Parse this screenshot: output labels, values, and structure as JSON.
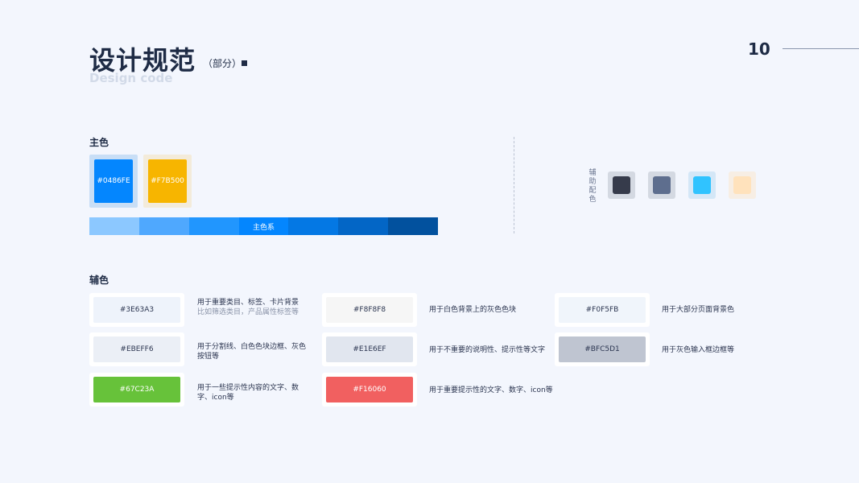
{
  "header": {
    "title": "设计规范",
    "title_sub": "（部分）",
    "subtitle": "Design code",
    "page_number": "10"
  },
  "primary": {
    "label": "主色",
    "swatches": [
      {
        "hex": "#0486FE",
        "color": "#0486FE",
        "frame": "#C8DEF6"
      },
      {
        "hex": "#F7B500",
        "color": "#F7B500",
        "frame": "#F3EBDA"
      }
    ],
    "scale": {
      "label": "主色系",
      "colors": [
        "#8CC8FF",
        "#4FA8FE",
        "#2196FE",
        "#0486FE",
        "#0478E4",
        "#0366C6",
        "#02519E"
      ]
    }
  },
  "aux_mini": {
    "label": "辅助配色",
    "swatches": [
      {
        "color": "#363B4B",
        "frame": "#D4D9E2"
      },
      {
        "color": "#5E6E8E",
        "frame": "#D4D9E2"
      },
      {
        "color": "#30C3FF",
        "frame": "#D4E7F7"
      },
      {
        "color": "#FFE2BC",
        "frame": "#F7EEE4"
      }
    ]
  },
  "secondary": {
    "label": "辅色",
    "items": [
      {
        "hex": "#3E63A3",
        "color": "#EEF3FB",
        "text_color": "#2B3550",
        "desc": "用于重要类目、标签、卡片背景",
        "desc2": "比如筛选类目，产品属性标签等"
      },
      {
        "hex": "#F8F8F8",
        "color": "#F6F6F6",
        "text_color": "#2B3550",
        "desc": "用于白色背景上的灰色色块",
        "desc2": ""
      },
      {
        "hex": "#F0F5FB",
        "color": "#F0F5FB",
        "text_color": "#2B3550",
        "desc": "用于大部分页面背景色",
        "desc2": ""
      },
      {
        "hex": "#EBEFF6",
        "color": "#EBEFF6",
        "text_color": "#2B3550",
        "desc": "用于分割线、白色色块边框、灰色按钮等",
        "desc2": ""
      },
      {
        "hex": "#E1E6EF",
        "color": "#E1E6EF",
        "text_color": "#2B3550",
        "desc": "用于不重要的说明性、提示性等文字",
        "desc2": ""
      },
      {
        "hex": "#BFC5D1",
        "color": "#BFC5D1",
        "text_color": "#2B3550",
        "desc": "用于灰色输入框边框等",
        "desc2": ""
      },
      {
        "hex": "#67C23A",
        "color": "#67C23A",
        "text_color": "#FFFFFF",
        "desc": "用于一些提示性内容的文字、数字、icon等",
        "desc2": ""
      },
      {
        "hex": "#F16060",
        "color": "#F16060",
        "text_color": "#FFFFFF",
        "desc": "用于重要提示性的文字、数字、icon等",
        "desc2": ""
      }
    ]
  }
}
